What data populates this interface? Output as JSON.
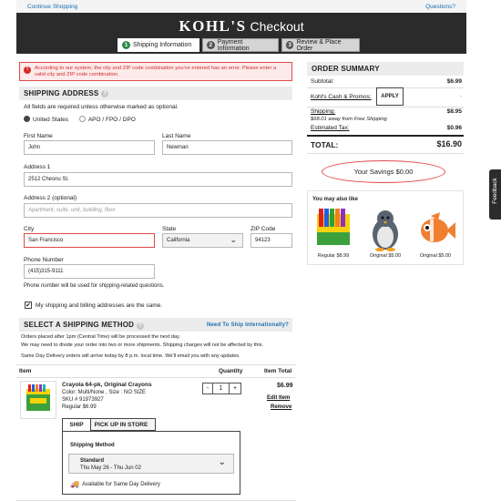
{
  "topbar": {
    "continue": "Continue Shopping",
    "questions": "Questions?"
  },
  "header": {
    "logo": "KOHL'S",
    "title": "Checkout"
  },
  "steps": [
    {
      "num": "1",
      "label": "Shipping Information"
    },
    {
      "num": "2",
      "label": "Payment Information"
    },
    {
      "num": "3",
      "label": "Review & Place Order"
    }
  ],
  "error": "According to our system, the city and ZIP code combination you've entered has an error. Please enter a valid city and ZIP code combination.",
  "shipping": {
    "title": "SHIPPING ADDRESS",
    "required_note": "All fields are required unless otherwise marked as optional.",
    "opt_us": "United States",
    "opt_apo": "APO / FPO / DPO",
    "first_label": "First Name",
    "first_value": "John",
    "last_label": "Last Name",
    "last_value": "Newman",
    "addr1_label": "Address 1",
    "addr1_value": "2512 Chesnu St.",
    "addr2_label": "Address 2 (optional)",
    "addr2_placeholder": "Apartment, suite, unit, building, floor",
    "city_label": "City",
    "city_value": "San Francisco",
    "state_label": "State",
    "state_value": "California",
    "zip_label": "ZIP Code",
    "zip_value": "94123",
    "phone_label": "Phone Number",
    "phone_value": "(415)315-9111",
    "phone_note": "Phone number will be used for shipping-related questions.",
    "same_address": "My shipping and billing addresses are the same."
  },
  "method": {
    "title": "SELECT A SHIPPING METHOD",
    "intl_link": "Need To Ship Internationally?",
    "note1": "Orders placed after 1pm (Central Time) will be processed the next day.",
    "note2": "We may need to divide your order into two or more shipments. Shipping charges will not be affected by this.",
    "note3": "Same Day Delivery orders will arrive today by 8 p.m. local time. We'll email you with any updates."
  },
  "table": {
    "col_item": "Item",
    "col_qty": "Quantity",
    "col_total": "Item Total"
  },
  "item": {
    "name": "Crayola 64-pk, Original Crayons",
    "color": "Color: Multi/None , Size : NO SIZE",
    "sku": "SKU # 91973927",
    "price": "Regular $6.99",
    "qty": "1",
    "minus": "-",
    "plus": "+",
    "total": "$6.99",
    "edit": "Edit Item",
    "remove": "Remove",
    "tab_ship": "SHIP",
    "tab_store": "PICK UP IN STORE",
    "method_label": "Shipping Method",
    "method_name": "Standard",
    "method_dates": "Thu May 26 - Thu Jun 02",
    "same_day": "Available for Same Day Delivery"
  },
  "summary": {
    "title": "ORDER SUMMARY",
    "subtotal_label": "Subtotal:",
    "subtotal": "$6.99",
    "kohls_cash": "Kohl's Cash & Promos:",
    "apply": "APPLY",
    "kohls_cash_value": "-",
    "shipping_label": "Shipping:",
    "shipping_value": "$8.95",
    "free_note": "$68.01 away from Free Shipping",
    "tax_label": "Estimated Tax:",
    "tax_value": "$0.96",
    "total_label": "TOTAL:",
    "total_value": "$16.90",
    "savings": "Your Savings $0.00"
  },
  "recs": {
    "title": "You may also like",
    "items": [
      {
        "price": "Regular $8.99"
      },
      {
        "price": "Original $5.00"
      },
      {
        "price": "Original $5.00"
      }
    ]
  },
  "feedback": "Feedback",
  "colors": {
    "header": "#2b2b2b",
    "error": "#e04848",
    "active_step": "#2e8b4a",
    "link": "#1a6fb3"
  }
}
